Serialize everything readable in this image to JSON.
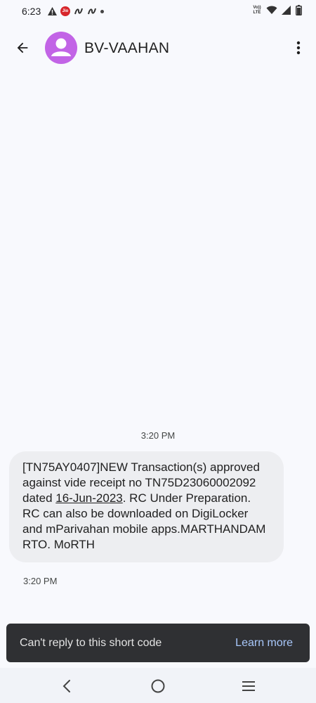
{
  "status_bar": {
    "time": "6:23",
    "volte_label": "Vo)) LTE",
    "left_icons": [
      "alert-icon",
      "jio-icon",
      "app-icon",
      "app-icon",
      "dot-icon"
    ],
    "right_icons": [
      "volte-icon",
      "wifi-icon",
      "signal-icon",
      "battery-icon"
    ]
  },
  "header": {
    "title": "BV-VAAHAN",
    "back_icon": "arrow-back-icon",
    "avatar_icon": "person-icon",
    "more_icon": "more-vert-icon",
    "avatar_color": "#c264e6"
  },
  "conversation": {
    "timestamp_header": "3:20 PM",
    "messages": [
      {
        "text_part1": "[TN75AY0407]NEW Transaction(s) approved against vide receipt no TN75D23060002092 dated ",
        "date_link": "16-Jun-2023",
        "text_part2": ". RC Under Preparation. RC can also be downloaded on DigiLocker and mParivahan mobile apps.MARTHANDAM RTO. MoRTH",
        "time": "3:20 PM"
      }
    ]
  },
  "snackbar": {
    "message": "Can't reply to this short code",
    "action": "Learn more",
    "action_color": "#a8c7fa"
  },
  "nav_bar": {
    "icons": [
      "nav-back-icon",
      "nav-home-icon",
      "nav-recents-icon"
    ]
  }
}
